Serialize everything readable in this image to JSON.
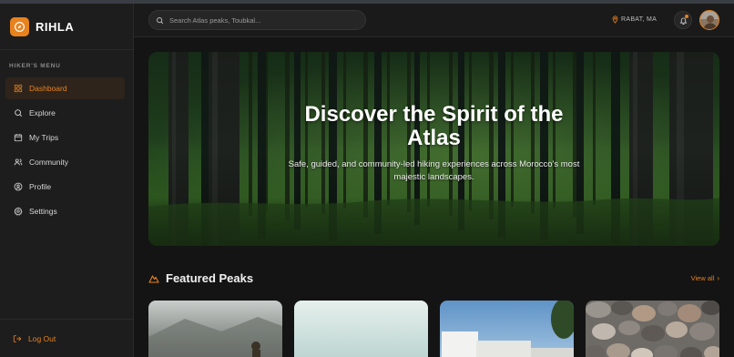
{
  "brand": {
    "name": "RIHLA",
    "logo_icon": "compass-icon",
    "accent_color": "#e8821e"
  },
  "sidebar": {
    "caption": "HIKER'S MENU",
    "items": [
      {
        "label": "Dashboard",
        "icon": "grid-icon",
        "active": true
      },
      {
        "label": "Explore",
        "icon": "search-icon",
        "active": false
      },
      {
        "label": "My Trips",
        "icon": "calendar-icon",
        "active": false
      },
      {
        "label": "Community",
        "icon": "users-icon",
        "active": false
      },
      {
        "label": "Profile",
        "icon": "user-circle-icon",
        "active": false
      },
      {
        "label": "Settings",
        "icon": "gear-icon",
        "active": false
      }
    ],
    "logout_label": "Log Out"
  },
  "header": {
    "search_placeholder": "Search Atlas peaks, Toubkal...",
    "location": "RABAT, MA",
    "notifications_icon": "bell-icon"
  },
  "hero": {
    "title": "Discover the Spirit of the Atlas",
    "subtitle": "Safe, guided, and community-led hiking experiences across Morocco's most majestic landscapes."
  },
  "featured": {
    "title": "Featured Peaks",
    "icon": "mountain-icon",
    "view_all_label": "View all",
    "cards": [
      {
        "image": "misty-mountain-hiker"
      },
      {
        "image": "pale-sky"
      },
      {
        "image": "white-buildings-blue-sky"
      },
      {
        "image": "pebbles"
      }
    ]
  }
}
